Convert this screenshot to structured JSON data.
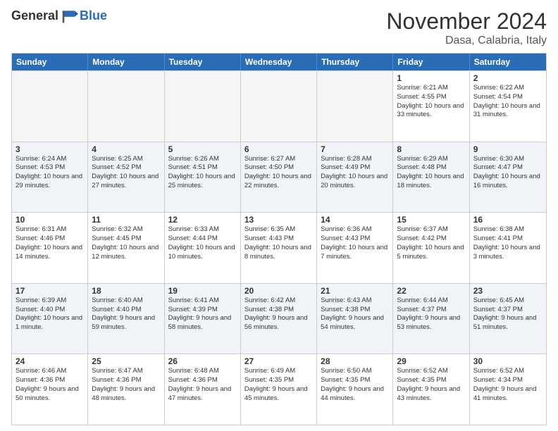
{
  "header": {
    "logo_general": "General",
    "logo_blue": "Blue",
    "month_title": "November 2024",
    "location": "Dasa, Calabria, Italy"
  },
  "days_of_week": [
    "Sunday",
    "Monday",
    "Tuesday",
    "Wednesday",
    "Thursday",
    "Friday",
    "Saturday"
  ],
  "weeks": [
    [
      {
        "day": "",
        "empty": true
      },
      {
        "day": "",
        "empty": true
      },
      {
        "day": "",
        "empty": true
      },
      {
        "day": "",
        "empty": true
      },
      {
        "day": "",
        "empty": true
      },
      {
        "day": "1",
        "info": "Sunrise: 6:21 AM\nSunset: 4:55 PM\nDaylight: 10 hours and 33 minutes."
      },
      {
        "day": "2",
        "info": "Sunrise: 6:22 AM\nSunset: 4:54 PM\nDaylight: 10 hours and 31 minutes."
      }
    ],
    [
      {
        "day": "3",
        "info": "Sunrise: 6:24 AM\nSunset: 4:53 PM\nDaylight: 10 hours and 29 minutes."
      },
      {
        "day": "4",
        "info": "Sunrise: 6:25 AM\nSunset: 4:52 PM\nDaylight: 10 hours and 27 minutes."
      },
      {
        "day": "5",
        "info": "Sunrise: 6:26 AM\nSunset: 4:51 PM\nDaylight: 10 hours and 25 minutes."
      },
      {
        "day": "6",
        "info": "Sunrise: 6:27 AM\nSunset: 4:50 PM\nDaylight: 10 hours and 22 minutes."
      },
      {
        "day": "7",
        "info": "Sunrise: 6:28 AM\nSunset: 4:49 PM\nDaylight: 10 hours and 20 minutes."
      },
      {
        "day": "8",
        "info": "Sunrise: 6:29 AM\nSunset: 4:48 PM\nDaylight: 10 hours and 18 minutes."
      },
      {
        "day": "9",
        "info": "Sunrise: 6:30 AM\nSunset: 4:47 PM\nDaylight: 10 hours and 16 minutes."
      }
    ],
    [
      {
        "day": "10",
        "info": "Sunrise: 6:31 AM\nSunset: 4:46 PM\nDaylight: 10 hours and 14 minutes."
      },
      {
        "day": "11",
        "info": "Sunrise: 6:32 AM\nSunset: 4:45 PM\nDaylight: 10 hours and 12 minutes."
      },
      {
        "day": "12",
        "info": "Sunrise: 6:33 AM\nSunset: 4:44 PM\nDaylight: 10 hours and 10 minutes."
      },
      {
        "day": "13",
        "info": "Sunrise: 6:35 AM\nSunset: 4:43 PM\nDaylight: 10 hours and 8 minutes."
      },
      {
        "day": "14",
        "info": "Sunrise: 6:36 AM\nSunset: 4:43 PM\nDaylight: 10 hours and 7 minutes."
      },
      {
        "day": "15",
        "info": "Sunrise: 6:37 AM\nSunset: 4:42 PM\nDaylight: 10 hours and 5 minutes."
      },
      {
        "day": "16",
        "info": "Sunrise: 6:38 AM\nSunset: 4:41 PM\nDaylight: 10 hours and 3 minutes."
      }
    ],
    [
      {
        "day": "17",
        "info": "Sunrise: 6:39 AM\nSunset: 4:40 PM\nDaylight: 10 hours and 1 minute."
      },
      {
        "day": "18",
        "info": "Sunrise: 6:40 AM\nSunset: 4:40 PM\nDaylight: 9 hours and 59 minutes."
      },
      {
        "day": "19",
        "info": "Sunrise: 6:41 AM\nSunset: 4:39 PM\nDaylight: 9 hours and 58 minutes."
      },
      {
        "day": "20",
        "info": "Sunrise: 6:42 AM\nSunset: 4:38 PM\nDaylight: 9 hours and 56 minutes."
      },
      {
        "day": "21",
        "info": "Sunrise: 6:43 AM\nSunset: 4:38 PM\nDaylight: 9 hours and 54 minutes."
      },
      {
        "day": "22",
        "info": "Sunrise: 6:44 AM\nSunset: 4:37 PM\nDaylight: 9 hours and 53 minutes."
      },
      {
        "day": "23",
        "info": "Sunrise: 6:45 AM\nSunset: 4:37 PM\nDaylight: 9 hours and 51 minutes."
      }
    ],
    [
      {
        "day": "24",
        "info": "Sunrise: 6:46 AM\nSunset: 4:36 PM\nDaylight: 9 hours and 50 minutes."
      },
      {
        "day": "25",
        "info": "Sunrise: 6:47 AM\nSunset: 4:36 PM\nDaylight: 9 hours and 48 minutes."
      },
      {
        "day": "26",
        "info": "Sunrise: 6:48 AM\nSunset: 4:36 PM\nDaylight: 9 hours and 47 minutes."
      },
      {
        "day": "27",
        "info": "Sunrise: 6:49 AM\nSunset: 4:35 PM\nDaylight: 9 hours and 45 minutes."
      },
      {
        "day": "28",
        "info": "Sunrise: 6:50 AM\nSunset: 4:35 PM\nDaylight: 9 hours and 44 minutes."
      },
      {
        "day": "29",
        "info": "Sunrise: 6:52 AM\nSunset: 4:35 PM\nDaylight: 9 hours and 43 minutes."
      },
      {
        "day": "30",
        "info": "Sunrise: 6:52 AM\nSunset: 4:34 PM\nDaylight: 9 hours and 41 minutes."
      }
    ]
  ]
}
